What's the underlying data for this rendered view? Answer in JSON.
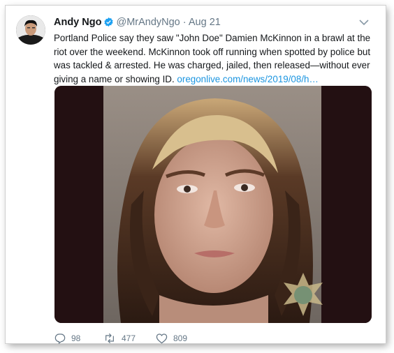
{
  "tweet": {
    "author_name": "Andy Ngo",
    "handle": "@MrAndyNgo",
    "separator": "·",
    "date": "Aug 21",
    "body": "Portland Police say they saw \"John Doe\" Damien McKinnon in a brawl at the riot over the weekend. McKinnon took off running when spotted by police but was tackled & arrested. He was charged, jailed, then released—without ever giving a name or showing ID.",
    "link_text": "oregonlive.com/news/2019/08/h…"
  },
  "actions": {
    "replies": "98",
    "retweets": "477",
    "likes": "809"
  },
  "icons": {
    "verified": "verified-badge-icon",
    "caret": "chevron-down-icon",
    "reply": "reply-icon",
    "retweet": "retweet-icon",
    "like": "heart-icon"
  },
  "colors": {
    "link": "#1b95e0",
    "verified": "#1da1f2",
    "muted": "#657786"
  }
}
